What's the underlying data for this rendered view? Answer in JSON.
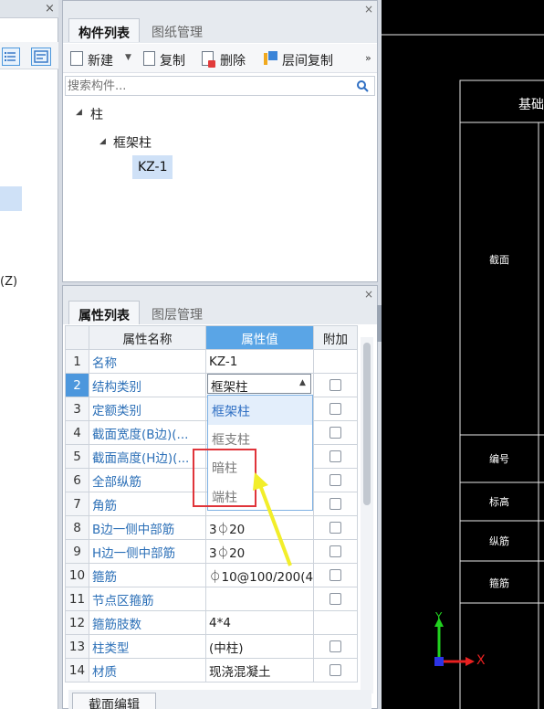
{
  "left": {
    "close": "×",
    "axis_label": "(Z)"
  },
  "component_panel": {
    "close": "×",
    "tabs": [
      {
        "label": "构件列表",
        "active": true
      },
      {
        "label": "图纸管理",
        "active": false
      }
    ],
    "toolbar": {
      "new": "新建",
      "copy": "复制",
      "delete": "删除",
      "floor_copy": "层间复制",
      "more": "»"
    },
    "search": {
      "placeholder": "搜索构件..."
    },
    "tree": {
      "root": "柱",
      "child": "框架柱",
      "leaf": "KZ-1"
    }
  },
  "property_panel": {
    "close": "×",
    "tabs": [
      {
        "label": "属性列表",
        "active": true
      },
      {
        "label": "图层管理",
        "active": false
      }
    ],
    "headers": {
      "name": "属性名称",
      "value": "属性值",
      "extra": "附加"
    },
    "rows": [
      {
        "n": "1",
        "name": "名称",
        "value": "KZ-1",
        "check": false
      },
      {
        "n": "2",
        "name": "结构类别",
        "value": "框架柱",
        "check": true
      },
      {
        "n": "3",
        "name": "定额类别",
        "value": "",
        "check": true
      },
      {
        "n": "4",
        "name": "截面宽度(B边)(...",
        "value": "",
        "check": true
      },
      {
        "n": "5",
        "name": "截面高度(H边)(...",
        "value": "",
        "check": true
      },
      {
        "n": "6",
        "name": "全部纵筋",
        "value": "",
        "check": true
      },
      {
        "n": "7",
        "name": "角筋",
        "value": "",
        "check": true
      },
      {
        "n": "8",
        "name": "B边一侧中部筋",
        "value": "3⏀20",
        "check": true
      },
      {
        "n": "9",
        "name": "H边一侧中部筋",
        "value": "3⏀20",
        "check": true
      },
      {
        "n": "10",
        "name": "箍筋",
        "value": "⏀10@100/200(4",
        "check": true
      },
      {
        "n": "11",
        "name": "节点区箍筋",
        "value": "",
        "check": true
      },
      {
        "n": "12",
        "name": "箍筋肢数",
        "value": "4*4",
        "check": false
      },
      {
        "n": "13",
        "name": "柱类型",
        "value": "(中柱)",
        "check": true
      },
      {
        "n": "14",
        "name": "材质",
        "value": "现浇混凝土",
        "check": true
      }
    ],
    "dropdown_options": [
      "框架柱",
      "框支柱",
      "暗柱",
      "端柱"
    ],
    "section_edit_button": "截面编辑"
  },
  "cad": {
    "header": "基础",
    "labels": [
      "截面",
      "编号",
      "标高",
      "纵筋",
      "箍筋"
    ],
    "axis_y": "Y",
    "axis_x": "X"
  },
  "colors": {
    "accent": "#5aa5e6",
    "selection": "#4c97dd",
    "highlight_box": "#e0343a",
    "arrow": "#f2ee2a",
    "axis_green": "#21d11f",
    "axis_red": "#e82020",
    "axis_blue": "#2c33e6"
  }
}
